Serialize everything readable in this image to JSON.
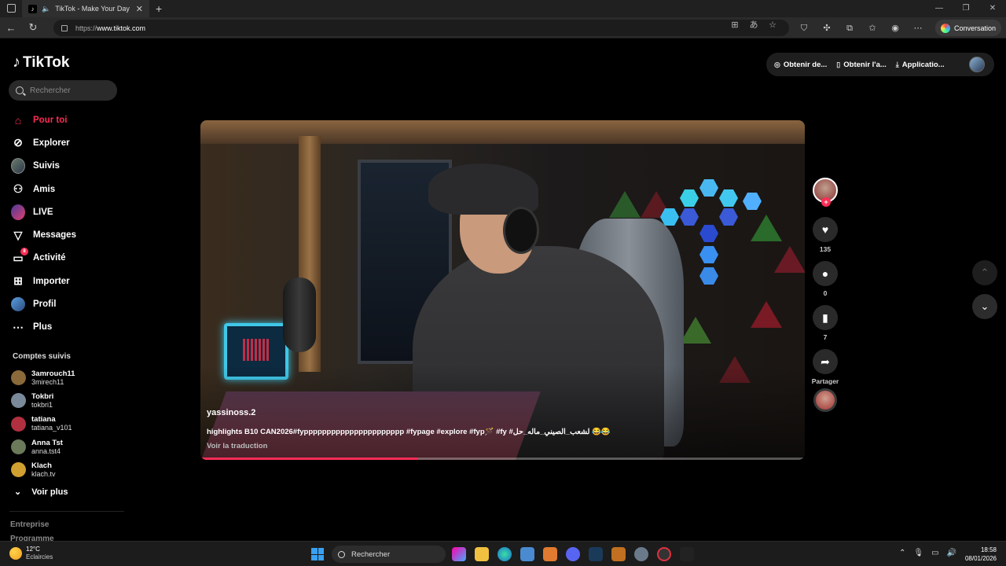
{
  "browser": {
    "tab_title": "TikTok - Make Your Day",
    "url_prefix": "https://",
    "url_domain": "www.tiktok.com",
    "conversation_label": "Conversation"
  },
  "sidebar": {
    "logo": "TikTok",
    "search_placeholder": "Rechercher",
    "items": [
      {
        "label": "Pour toi",
        "icon": "home-icon",
        "active": true
      },
      {
        "label": "Explorer",
        "icon": "compass-icon"
      },
      {
        "label": "Suivis",
        "icon": "following-avatar-icon"
      },
      {
        "label": "Amis",
        "icon": "friends-icon"
      },
      {
        "label": "LIVE",
        "icon": "live-icon"
      },
      {
        "label": "Messages",
        "icon": "send-icon"
      },
      {
        "label": "Activité",
        "icon": "inbox-icon",
        "badge": "8"
      },
      {
        "label": "Importer",
        "icon": "plus-square-icon"
      },
      {
        "label": "Profil",
        "icon": "profile-avatar-icon"
      },
      {
        "label": "Plus",
        "icon": "more-dots-icon"
      }
    ],
    "following_title": "Comptes suivis",
    "following": [
      {
        "name": "3amrouch11",
        "handle": "3mirech11",
        "color": "#8a6a3a"
      },
      {
        "name": "Tokbri",
        "handle": "tokbri1",
        "color": "#7a8a9a"
      },
      {
        "name": "tatiana",
        "handle": "tatiana_v101",
        "color": "#b03040"
      },
      {
        "name": "Anna Tst",
        "handle": "anna.tst4",
        "color": "#6a7a5a"
      },
      {
        "name": "Klach",
        "handle": "klach.tv",
        "color": "#d0a030"
      }
    ],
    "see_more": "Voir plus",
    "footer": [
      "Entreprise",
      "Programme"
    ]
  },
  "header": {
    "get_coins": "Obtenir de...",
    "get_app": "Obtenir l'a...",
    "application": "Applicatio..."
  },
  "video": {
    "username": "yassinoss.2",
    "caption": "highlights B10 CAN2026#fypppppppppppppppppppppp #fypage #explore #fyp🪄 #fy #لشعب_الصيني_ماله_حل 😂😂",
    "translate": "Voir la traduction",
    "progress": 0.36
  },
  "actions": {
    "likes": "135",
    "comments": "0",
    "saves": "7",
    "share": "Partager"
  },
  "taskbar": {
    "temp": "12°C",
    "weather": "Eclaircies",
    "search": "Rechercher",
    "time": "18:58",
    "date": "08/01/2026"
  }
}
